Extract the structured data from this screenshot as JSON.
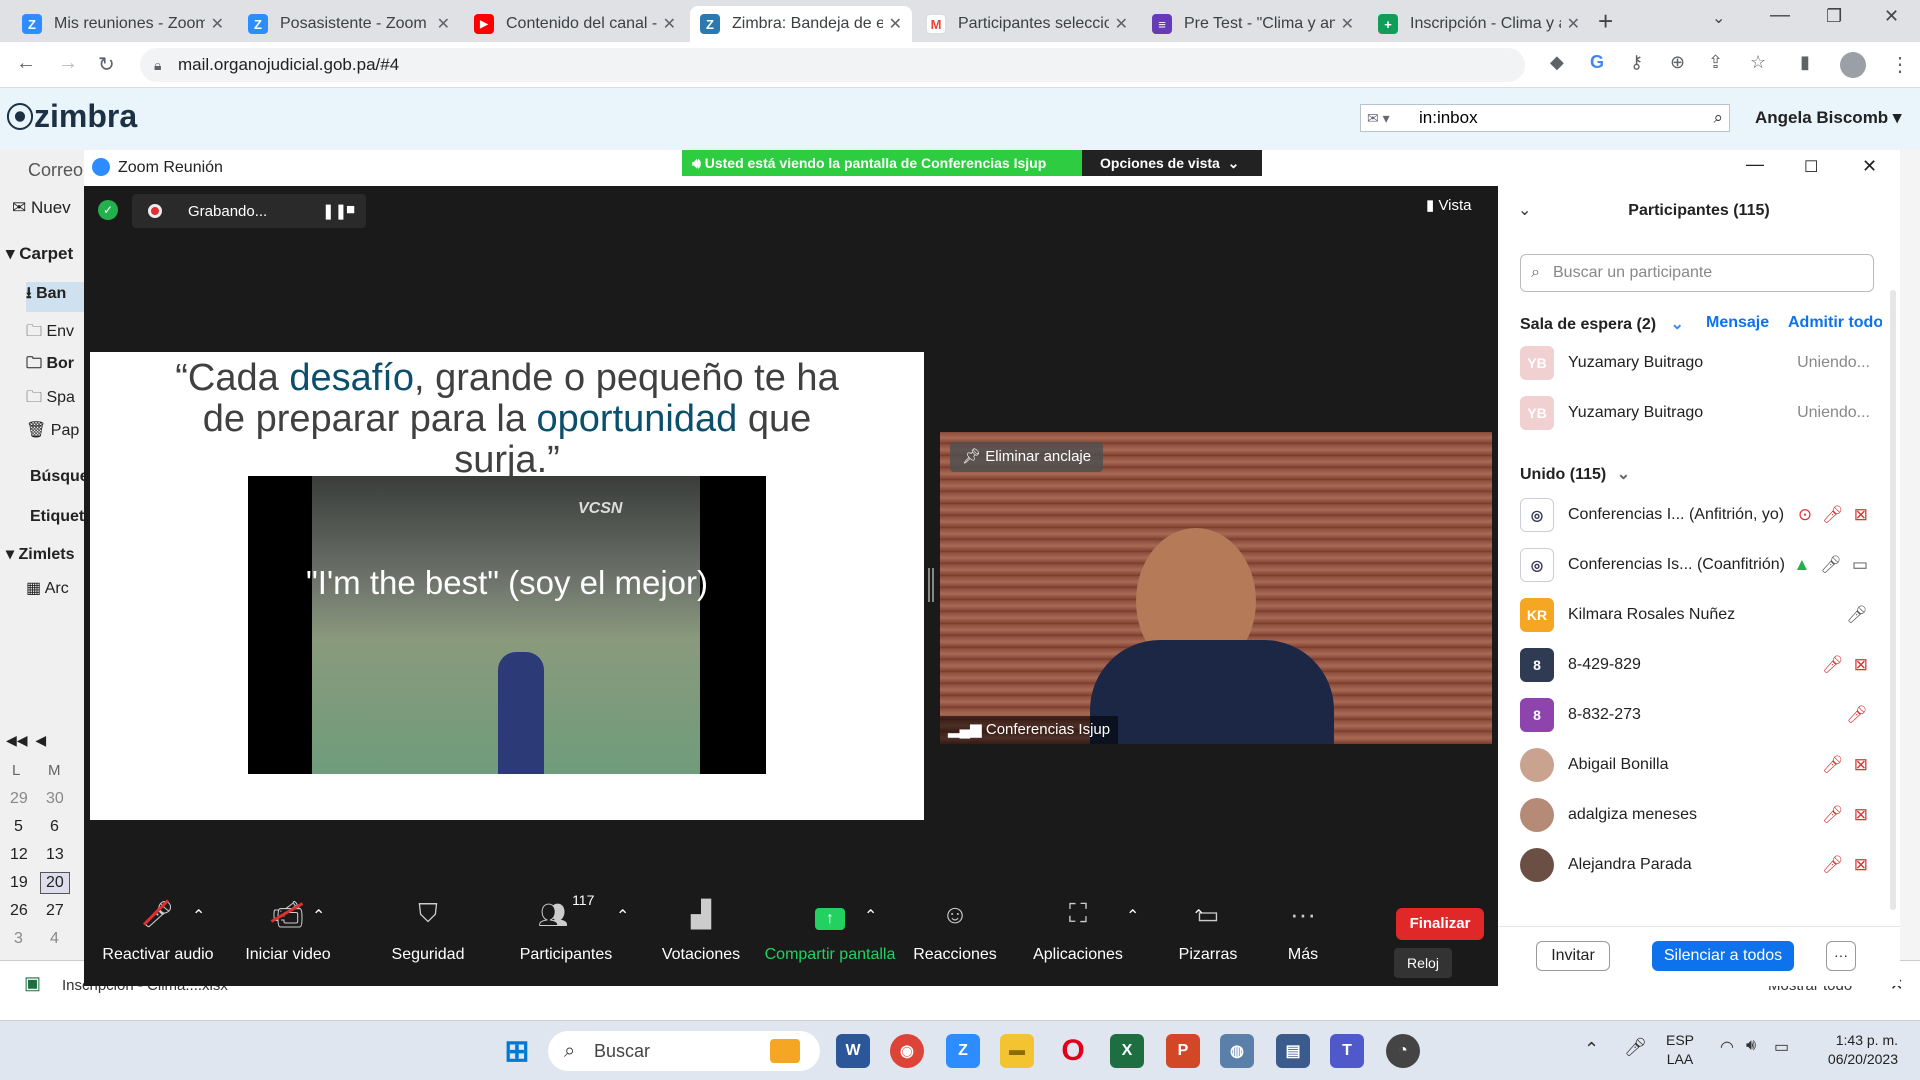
{
  "browser": {
    "tabs": [
      {
        "label": "Mis reuniones - Zoom",
        "color": "#2d8cff",
        "glyph": "Z"
      },
      {
        "label": "Posasistente - Zoom",
        "color": "#2d8cff",
        "glyph": "Z"
      },
      {
        "label": "Contenido del canal -",
        "color": "#ff0000",
        "glyph": "▶"
      },
      {
        "label": "Zimbra: Bandeja de en",
        "color": "#2a7ab0",
        "glyph": "Z"
      },
      {
        "label": "Participantes seleccio",
        "color": "#ea4335",
        "glyph": "M"
      },
      {
        "label": "Pre Test - \"Clima y am",
        "color": "#673ab7",
        "glyph": "≡"
      },
      {
        "label": "Inscripción - Clima y a",
        "color": "#0f9d58",
        "glyph": "+"
      }
    ],
    "url": "mail.organojudicial.gob.pa/#4"
  },
  "zimbra": {
    "logo": "zimbra",
    "search_value": "in:inbox",
    "user": "Angela Biscomb",
    "left": {
      "correo": "Correo",
      "nuevo": "Nuev",
      "carpetas": "Carpet",
      "items": [
        "Ban",
        "Env",
        "Bor",
        "Spa",
        "Pap"
      ],
      "busque": "Búsque",
      "etique": "Etiquet",
      "zimlets": "Zimlets",
      "arc": "Arc"
    },
    "calendar": {
      "days": [
        "L",
        "M"
      ],
      "rows": [
        [
          "29",
          "30"
        ],
        [
          "5",
          "6"
        ],
        [
          "12",
          "13"
        ],
        [
          "19",
          "20"
        ],
        [
          "26",
          "27"
        ],
        [
          "3",
          "4"
        ]
      ]
    },
    "download": "Inscripcion - Clima....xlsx",
    "mostrar": "Mostrar todo"
  },
  "zoom": {
    "title": "Zoom Reunión",
    "share_banner": "Usted está viendo la pantalla de Conferencias Isjup",
    "view_options": "Opciones de vista",
    "recording": "Grabando...",
    "vista": "Vista",
    "slide": {
      "quote_open": "“Cada ",
      "quote_w1": "desafío",
      "quote_mid": ", grande o pequeño te ha de preparar para la ",
      "quote_w2": "oportunidad",
      "quote_end": " que surja.”",
      "video_caption": "\"I'm the best\" (soy el mejor)",
      "video_logo": "VCSN"
    },
    "video": {
      "unpin": "Eliminar anclaje",
      "name": "Conferencias Isjup"
    },
    "toolbar": {
      "audio": "Reactivar audio",
      "video": "Iniciar video",
      "security": "Seguridad",
      "participants": "Participantes",
      "participants_count": "117",
      "polls": "Votaciones",
      "share": "Compartir pantalla",
      "reactions": "Reacciones",
      "apps": "Aplicaciones",
      "whiteboards": "Pizarras",
      "more": "Más",
      "end": "Finalizar",
      "clock_tooltip": "Reloj"
    },
    "panel": {
      "title": "Participantes (115)",
      "search_placeholder": "Buscar un participante",
      "waiting": "Sala de espera (2)",
      "message": "Mensaje",
      "admit_all": "Admitir todo",
      "waiting_list": [
        {
          "initials": "YB",
          "name": "Yuzamary Buitrago",
          "status": "Uniendo..."
        },
        {
          "initials": "YB",
          "name": "Yuzamary Buitrago",
          "status": "Uniendo..."
        }
      ],
      "joined": "Unido (115)",
      "joined_list": [
        {
          "initials": "",
          "name": "Conferencias I...  (Anfitrión, yo)",
          "color": "#ffffff"
        },
        {
          "initials": "",
          "name": "Conferencias Is...  (Coanfitrión)",
          "color": "#ffffff"
        },
        {
          "initials": "KR",
          "name": "Kilmara Rosales Nuñez",
          "color": "#f5a623"
        },
        {
          "initials": "8",
          "name": "8-429-829",
          "color": "#2f3b52"
        },
        {
          "initials": "8",
          "name": "8-832-273",
          "color": "#8e44ad"
        },
        {
          "initials": "",
          "name": "Abigail Bonilla",
          "color": "#c9a38f"
        },
        {
          "initials": "",
          "name": "adalgiza meneses",
          "color": "#b58a76"
        },
        {
          "initials": "",
          "name": "Alejandra Parada",
          "color": "#6b4f44"
        }
      ],
      "invite": "Invitar",
      "mute_all": "Silenciar a todos",
      "more": "···"
    }
  },
  "taskbar": {
    "search": "Buscar",
    "lang1": "ESP",
    "lang2": "LAA",
    "time": "1:43 p. m.",
    "date": "06/20/2023"
  }
}
